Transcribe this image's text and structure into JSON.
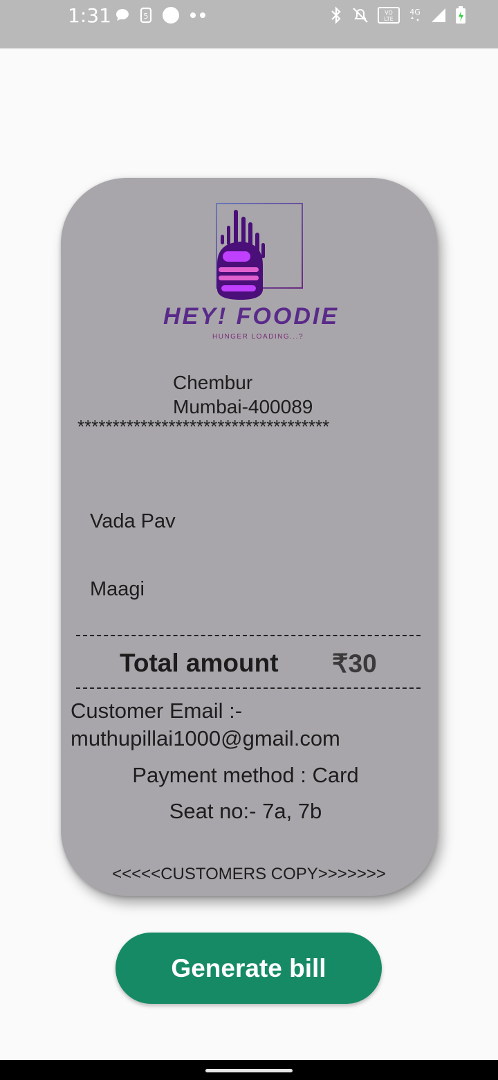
{
  "status_bar": {
    "time": "1:31",
    "left_icons": [
      "chat-bubble-icon",
      "sim-icon",
      "circle-icon",
      "dots-icon"
    ],
    "right_icons": [
      "bluetooth-icon",
      "mute-icon",
      "volte-icon",
      "4g-icon",
      "signal-icon",
      "battery-charging-icon"
    ],
    "volte_text": "VO LTE",
    "network_text": "4G"
  },
  "receipt": {
    "logo": {
      "brand": "HEY! FOODIE",
      "tagline": "HUNGER LOADING...?"
    },
    "address_line1": "Chembur",
    "address_line2": "Mumbai-400089",
    "stars": "************************************",
    "items": [
      "Vada Pav",
      "Maagi"
    ],
    "total_label": "Total amount",
    "total_value": "₹30",
    "email_label": "Customer Email :-",
    "email_value": "muthupillai1000@gmail.com",
    "payment_method": "Payment method : Card",
    "seat": "Seat no:- 7a, 7b",
    "copy_label": "<<<<<CUSTOMERS COPY>>>>>>>"
  },
  "actions": {
    "generate_bill_label": "Generate bill"
  },
  "colors": {
    "status_bar": "#b9b9b9",
    "card": "#a8a6aa",
    "button": "#168a65",
    "logo_purple": "#5a1a8a"
  }
}
